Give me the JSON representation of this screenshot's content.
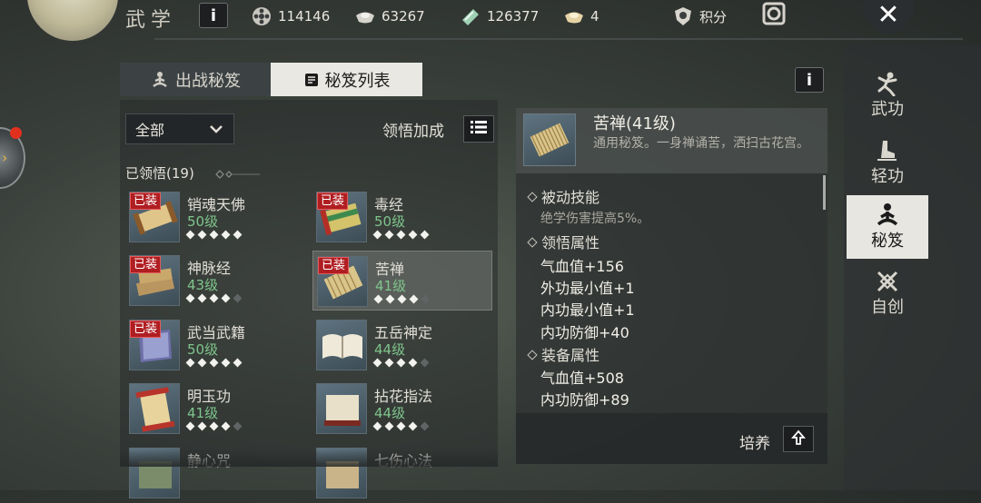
{
  "header": {
    "title": "武学",
    "resources": [
      {
        "icon": "film-reel-icon",
        "value": "114146"
      },
      {
        "icon": "silver-ingot-icon",
        "value": "63267"
      },
      {
        "icon": "jade-token-icon",
        "value": "126377"
      },
      {
        "icon": "gold-ingot-icon",
        "value": "4"
      }
    ],
    "points_label": "积分"
  },
  "tabs": [
    {
      "label": "出战秘笈",
      "active": false
    },
    {
      "label": "秘笈列表",
      "active": true
    }
  ],
  "filter": {
    "dropdown_value": "全部",
    "bonus_label": "领悟加成"
  },
  "section": {
    "label": "已领悟(19)"
  },
  "manuals": [
    {
      "name": "销魂天佛",
      "level": "50级",
      "equipped": true,
      "stars": 5,
      "tag": "已装",
      "selected": false
    },
    {
      "name": "毒经",
      "level": "50级",
      "equipped": true,
      "stars": 5,
      "tag": "已装",
      "selected": false
    },
    {
      "name": "神脉经",
      "level": "43级",
      "equipped": true,
      "stars": 4,
      "tag": "已装",
      "selected": false
    },
    {
      "name": "苦禅",
      "level": "41级",
      "equipped": true,
      "stars": 4,
      "tag": "已装",
      "selected": true
    },
    {
      "name": "武当武籍",
      "level": "50级",
      "equipped": true,
      "stars": 5,
      "tag": "已装",
      "selected": false
    },
    {
      "name": "五岳神定",
      "level": "44级",
      "equipped": false,
      "stars": 4,
      "tag": "",
      "selected": false
    },
    {
      "name": "明玉功",
      "level": "41级",
      "equipped": false,
      "stars": 4,
      "tag": "",
      "selected": false
    },
    {
      "name": "拈花指法",
      "level": "44级",
      "equipped": false,
      "stars": 4,
      "tag": "",
      "selected": false
    },
    {
      "name": "静心咒",
      "level": "",
      "equipped": false,
      "stars": 0,
      "tag": "",
      "selected": false
    },
    {
      "name": "七伤心法",
      "level": "",
      "equipped": false,
      "stars": 0,
      "tag": "",
      "selected": false
    }
  ],
  "detail": {
    "name": "苦禅(41级)",
    "description": "通用秘笈。一身禅诵苦，洒扫古花宫。",
    "passive_title": "被动技能",
    "passive_text": "绝学伤害提高5%。",
    "comprehend_title": "领悟属性",
    "comprehend_stats": [
      "气血值+156",
      "外功最小值+1",
      "内功最小值+1",
      "内功防御+40"
    ],
    "equip_title": "装备属性",
    "equip_stats": [
      "气血值+508",
      "内功防御+89"
    ],
    "cultivate_label": "培养"
  },
  "sidenav": [
    {
      "label": "武功",
      "icon": "martial-figure-icon",
      "active": false
    },
    {
      "label": "轻功",
      "icon": "flying-boot-icon",
      "active": false
    },
    {
      "label": "秘笈",
      "icon": "meditation-icon",
      "active": true
    },
    {
      "label": "自创",
      "icon": "crossed-swords-icon",
      "active": false
    }
  ],
  "colors": {
    "equip_red": "#b01e22",
    "level_green": "#7fc58b",
    "active_tab": "#e9e8e3"
  }
}
